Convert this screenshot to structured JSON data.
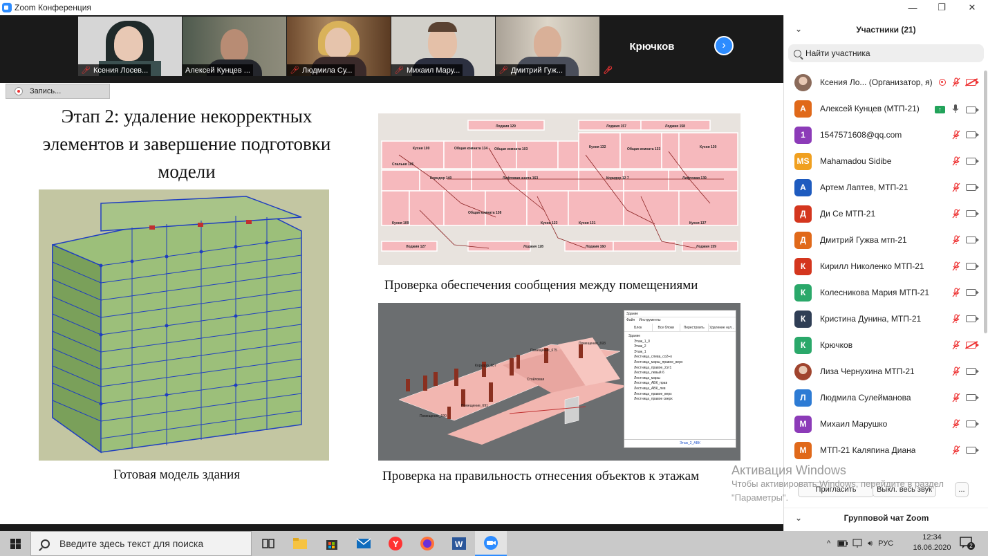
{
  "window": {
    "title": "Zoom Конференция",
    "controls": [
      "—",
      "❐",
      "✕"
    ]
  },
  "videos": [
    {
      "name": "Ксения Лосев...",
      "muted": true
    },
    {
      "name": "Алексей Кунцев ...",
      "muted": false
    },
    {
      "name": "Людмила Су...",
      "muted": true
    },
    {
      "name": "Михаил Мару...",
      "muted": true
    },
    {
      "name": "Дмитрий Гуж...",
      "muted": true
    },
    {
      "name": "Крючков",
      "muted": true
    }
  ],
  "recording": {
    "label": "Запись..."
  },
  "slide": {
    "title": "Этап 2: удаление некорректных элементов и завершение подготовки модели",
    "caption_model": "Готовая модель здания",
    "caption_plan": "Проверка обеспечения сообщения между помещениями",
    "caption_floors": "Проверка на правильность отнесения объектов к этажам",
    "tree_window": {
      "title": "Здание",
      "menu": [
        "Файл",
        "Инструменты"
      ],
      "tabs": [
        "Блок",
        "Все блоки",
        "Перестроить",
        "Удаление нул..."
      ],
      "items": [
        "Здание",
        "Этаж_1_0",
        "Этаж_2",
        "Этаж_1",
        "Лестница_слева_со2+о",
        "Лестница_марш_правое_верх",
        "Лестница_правое_2эт1",
        "Лестница_левый 6",
        "Лестница_марш",
        "Лестница_АВК_прав",
        "Лестница_АВК_лев",
        "Лестница_правое_верх",
        "Лестница_правое сверх"
      ],
      "footer": "Этаж_2_АВК"
    }
  },
  "watermark": {
    "title": "Активация Windows",
    "line1": "Чтобы активировать Windows, перейдите в раздел",
    "line2": "\"Параметры\"."
  },
  "panel": {
    "title": "Участники (21)",
    "search_placeholder": "Найти участника",
    "participants": [
      {
        "initials": "",
        "name": "Ксения Ло...  (Организатор, я)",
        "color": "#8a6a5a",
        "photo": true,
        "mic": "off",
        "cam": "off",
        "rec": true
      },
      {
        "initials": "А",
        "name": "Алексей Кунцев (МТП-21)",
        "color": "#e0691a",
        "mic": "on",
        "cam": "on",
        "share": true
      },
      {
        "initials": "1",
        "name": "1547571608@qq.com",
        "color": "#8c3bb8",
        "mic": "off",
        "cam": "on"
      },
      {
        "initials": "MS",
        "name": "Mahamadou Sidibe",
        "color": "#f0a020",
        "mic": "off",
        "cam": "on"
      },
      {
        "initials": "А",
        "name": "Артем Лаптев, МТП-21",
        "color": "#1e5bbf",
        "mic": "off",
        "cam": "on"
      },
      {
        "initials": "Д",
        "name": "Ди Се МТП-21",
        "color": "#d4361e",
        "mic": "off",
        "cam": "on"
      },
      {
        "initials": "Д",
        "name": "Дмитрий Гужва мтп-21",
        "color": "#e0691a",
        "mic": "off",
        "cam": "on"
      },
      {
        "initials": "К",
        "name": "Кирилл Николенко МТП-21",
        "color": "#d4361e",
        "mic": "off",
        "cam": "on"
      },
      {
        "initials": "К",
        "name": "Колесникова Мария МТП-21",
        "color": "#2aa86a",
        "mic": "off",
        "cam": "on"
      },
      {
        "initials": "К",
        "name": "Кристина Дунина, МТП-21",
        "color": "#2f3e55",
        "mic": "off",
        "cam": "on"
      },
      {
        "initials": "К",
        "name": "Крючков",
        "color": "#2aa86a",
        "mic": "off",
        "cam": "off"
      },
      {
        "initials": "",
        "name": "Лиза Чернухина МТП-21",
        "color": "#a0442e",
        "photo": true,
        "mic": "off",
        "cam": "on"
      },
      {
        "initials": "Л",
        "name": "Людмила Сулейманова",
        "color": "#2d7bd4",
        "mic": "off",
        "cam": "on"
      },
      {
        "initials": "М",
        "name": "Михаил Марушко",
        "color": "#8c3bb8",
        "mic": "off",
        "cam": "on"
      },
      {
        "initials": "М",
        "name": "МТП-21 Каляпина Диана",
        "color": "#e0691a",
        "mic": "off",
        "cam": "on"
      }
    ],
    "invite_label": "Пригласить",
    "mute_all_label": "Выкл. весь звук",
    "more_label": "...",
    "chat_title": "Групповой чат Zoom"
  },
  "taskbar": {
    "search_placeholder": "Введите здесь текст для поиска",
    "lang": "РУС",
    "time": "12:34",
    "date": "16.06.2020",
    "notifications": "2"
  }
}
